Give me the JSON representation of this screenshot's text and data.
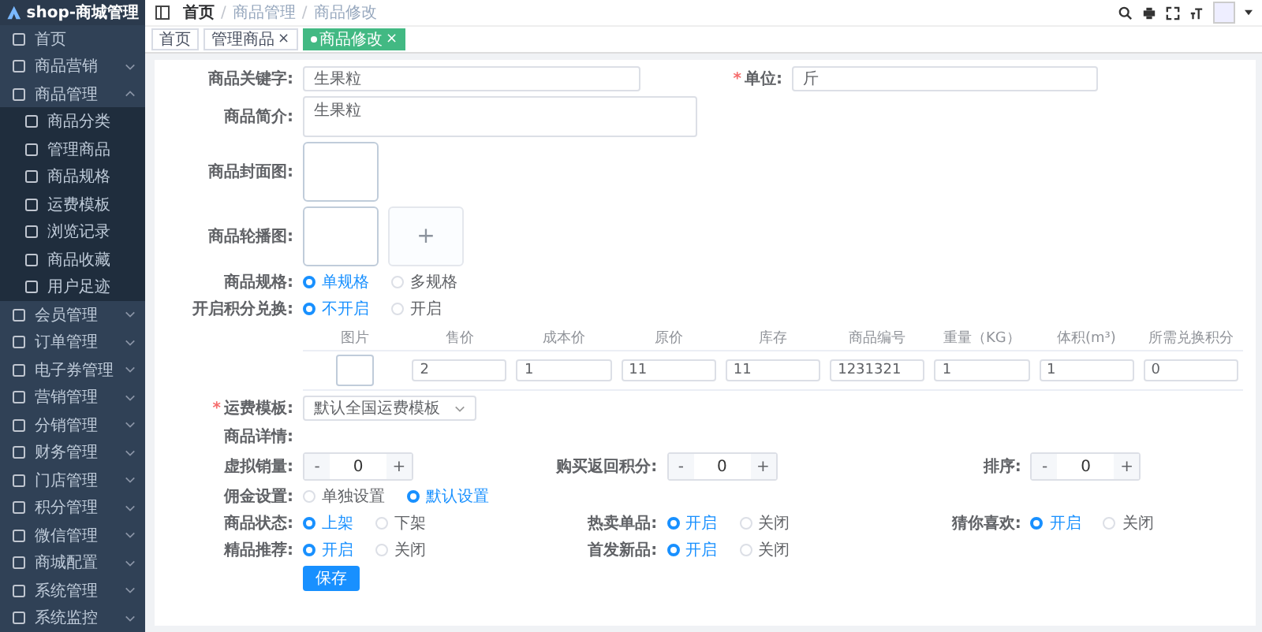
{
  "sidebar": {
    "logo": "shop-商城管理",
    "items": [
      {
        "label": "首页"
      },
      {
        "label": "商品营销",
        "expanded": false
      },
      {
        "label": "商品管理",
        "expanded": true,
        "children": [
          {
            "label": "商品分类"
          },
          {
            "label": "管理商品"
          },
          {
            "label": "商品规格"
          },
          {
            "label": "运费模板"
          },
          {
            "label": "浏览记录"
          },
          {
            "label": "商品收藏"
          },
          {
            "label": "用户足迹"
          }
        ]
      },
      {
        "label": "会员管理",
        "expanded": false
      },
      {
        "label": "订单管理",
        "expanded": false
      },
      {
        "label": "电子券管理",
        "expanded": false
      },
      {
        "label": "营销管理",
        "expanded": false
      },
      {
        "label": "分销管理",
        "expanded": false
      },
      {
        "label": "财务管理",
        "expanded": false
      },
      {
        "label": "门店管理",
        "expanded": false
      },
      {
        "label": "积分管理",
        "expanded": false
      },
      {
        "label": "微信管理",
        "expanded": false
      },
      {
        "label": "商城配置",
        "expanded": false
      },
      {
        "label": "系统管理",
        "expanded": false
      },
      {
        "label": "系统监控",
        "expanded": false
      }
    ]
  },
  "breadcrumb": [
    "首页",
    "商品管理",
    "商品修改"
  ],
  "breadcrumb_separator": "/",
  "required_mark": "*",
  "tags": [
    {
      "label": "首页",
      "selected": false,
      "closable": false
    },
    {
      "label": "管理商品",
      "selected": false,
      "closable": true
    },
    {
      "label": "商品修改",
      "selected": true,
      "closable": true
    }
  ],
  "tag_close": "×",
  "form": {
    "rows": [
      [
        {
          "kind": "text",
          "label": "商品关键字:",
          "required": false,
          "value": "生果粒"
        },
        {
          "kind": "text",
          "label": "单位:",
          "required": true,
          "value": "斤"
        }
      ],
      [
        {
          "kind": "textarea",
          "label": "商品简介:",
          "value": "生果粒"
        }
      ],
      [
        {
          "kind": "image",
          "label": "商品封面图:"
        }
      ],
      [
        {
          "kind": "gallery",
          "label": "商品轮播图:",
          "add": "+"
        }
      ],
      [
        {
          "kind": "radio",
          "label": "商品规格:",
          "options": [
            {
              "label": "单规格",
              "selected": true
            },
            {
              "label": "多规格",
              "selected": false
            }
          ]
        }
      ],
      [
        {
          "kind": "radio",
          "label": "开启积分兑换:",
          "options": [
            {
              "label": "不开启",
              "selected": true
            },
            {
              "label": "开启",
              "selected": false
            }
          ]
        }
      ],
      [
        {
          "kind": "table",
          "columns": [
            "图片",
            "售价",
            "成本价",
            "原价",
            "库存",
            "商品编号",
            "重量（KG）",
            "体积(m³)",
            "所需兑换积分"
          ],
          "rows": [
            {
              "values": [
                "2",
                "1",
                "11",
                "11",
                "1231321",
                "1",
                "1",
                "0"
              ]
            }
          ]
        }
      ],
      [
        {
          "kind": "select",
          "label": "运费模板:",
          "required": true,
          "value": "默认全国运费模板"
        }
      ],
      [
        {
          "kind": "empty",
          "label": "商品详情:"
        }
      ],
      [
        {
          "kind": "stepper",
          "label": "虚拟销量:",
          "value": "0",
          "minus": "-",
          "plus": "+"
        },
        {
          "kind": "stepper",
          "label": "购买返回积分:",
          "value": "0",
          "minus": "-",
          "plus": "+"
        },
        {
          "kind": "stepper",
          "label": "排序:",
          "value": "0",
          "minus": "-",
          "plus": "+"
        }
      ],
      [
        {
          "kind": "radio",
          "label": "佣金设置:",
          "options": [
            {
              "label": "单独设置",
              "selected": false
            },
            {
              "label": "默认设置",
              "selected": true
            }
          ]
        }
      ],
      [
        {
          "kind": "radio",
          "label": "商品状态:",
          "options": [
            {
              "label": "上架",
              "selected": true
            },
            {
              "label": "下架",
              "selected": false
            }
          ]
        },
        {
          "kind": "radio",
          "label": "热卖单品:",
          "options": [
            {
              "label": "开启",
              "selected": true
            },
            {
              "label": "关闭",
              "selected": false
            }
          ]
        },
        {
          "kind": "radio",
          "label": "猜你喜欢:",
          "options": [
            {
              "label": "开启",
              "selected": true
            },
            {
              "label": "关闭",
              "selected": false
            }
          ]
        }
      ],
      [
        {
          "kind": "radio",
          "label": "精品推荐:",
          "options": [
            {
              "label": "开启",
              "selected": true
            },
            {
              "label": "关闭",
              "selected": false
            }
          ]
        },
        {
          "kind": "radio",
          "label": "首发新品:",
          "options": [
            {
              "label": "开启",
              "selected": true
            },
            {
              "label": "关闭",
              "selected": false
            }
          ]
        }
      ]
    ],
    "save": "保存"
  }
}
